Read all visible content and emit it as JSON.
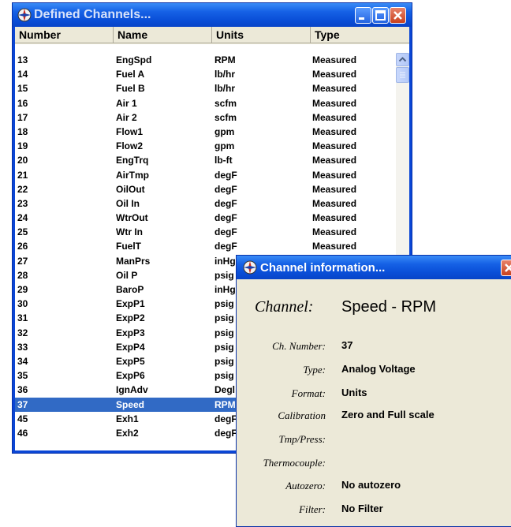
{
  "channels_window": {
    "title": "Defined Channels...",
    "columns": [
      "Number",
      "Name",
      "Units",
      "Type"
    ],
    "rows": [
      {
        "number": "13",
        "name": "EngSpd",
        "units": "RPM",
        "type": "Measured"
      },
      {
        "number": "14",
        "name": "Fuel A",
        "units": "lb/hr",
        "type": "Measured"
      },
      {
        "number": "15",
        "name": "Fuel B",
        "units": "lb/hr",
        "type": "Measured"
      },
      {
        "number": "16",
        "name": "Air 1",
        "units": "scfm",
        "type": "Measured"
      },
      {
        "number": "17",
        "name": "Air 2",
        "units": "scfm",
        "type": "Measured"
      },
      {
        "number": "18",
        "name": "Flow1",
        "units": "gpm",
        "type": "Measured"
      },
      {
        "number": "19",
        "name": "Flow2",
        "units": "gpm",
        "type": "Measured"
      },
      {
        "number": "20",
        "name": "EngTrq",
        "units": "lb-ft",
        "type": "Measured"
      },
      {
        "number": "21",
        "name": "AirTmp",
        "units": "degF",
        "type": "Measured"
      },
      {
        "number": "22",
        "name": "OilOut",
        "units": "degF",
        "type": "Measured"
      },
      {
        "number": "23",
        "name": "Oil In",
        "units": "degF",
        "type": "Measured"
      },
      {
        "number": "24",
        "name": "WtrOut",
        "units": "degF",
        "type": "Measured"
      },
      {
        "number": "25",
        "name": "Wtr In",
        "units": "degF",
        "type": "Measured"
      },
      {
        "number": "26",
        "name": "FuelT",
        "units": "degF",
        "type": "Measured"
      },
      {
        "number": "27",
        "name": "ManPrs",
        "units": "inHg",
        "type": ""
      },
      {
        "number": "28",
        "name": "Oil P",
        "units": "psig",
        "type": ""
      },
      {
        "number": "29",
        "name": "BaroP",
        "units": "inHg",
        "type": ""
      },
      {
        "number": "30",
        "name": "ExpP1",
        "units": "psig",
        "type": ""
      },
      {
        "number": "31",
        "name": "ExpP2",
        "units": "psig",
        "type": ""
      },
      {
        "number": "32",
        "name": "ExpP3",
        "units": "psig",
        "type": ""
      },
      {
        "number": "33",
        "name": "ExpP4",
        "units": "psig",
        "type": ""
      },
      {
        "number": "34",
        "name": "ExpP5",
        "units": "psig",
        "type": ""
      },
      {
        "number": "35",
        "name": "ExpP6",
        "units": "psig",
        "type": ""
      },
      {
        "number": "36",
        "name": "IgnAdv",
        "units": "Degl",
        "type": ""
      },
      {
        "number": "37",
        "name": "Speed",
        "units": "RPM",
        "type": "",
        "selected": true
      },
      {
        "number": "45",
        "name": "Exh1",
        "units": "degF",
        "type": ""
      },
      {
        "number": "46",
        "name": "Exh2",
        "units": "degF",
        "type": ""
      }
    ],
    "selected_row_color": "#316ac5"
  },
  "info_window": {
    "title": "Channel information...",
    "channel_label": "Channel:",
    "channel_value": "Speed - RPM",
    "fields": [
      {
        "label": "Ch. Number:",
        "value": "37"
      },
      {
        "label": "Type:",
        "value": "Analog Voltage"
      },
      {
        "label": "Format:",
        "value": "Units"
      },
      {
        "label": "Calibration",
        "value": "Zero and Full scale"
      },
      {
        "label": "Tmp/Press:",
        "value": ""
      },
      {
        "label": "Thermocouple:",
        "value": ""
      },
      {
        "label": "Autozero:",
        "value": "No autozero"
      },
      {
        "label": "Filter:",
        "value": "No Filter"
      }
    ]
  },
  "icons": [
    "app-icon",
    "minimize-icon",
    "maximize-icon",
    "close-icon",
    "scroll-up-icon"
  ]
}
